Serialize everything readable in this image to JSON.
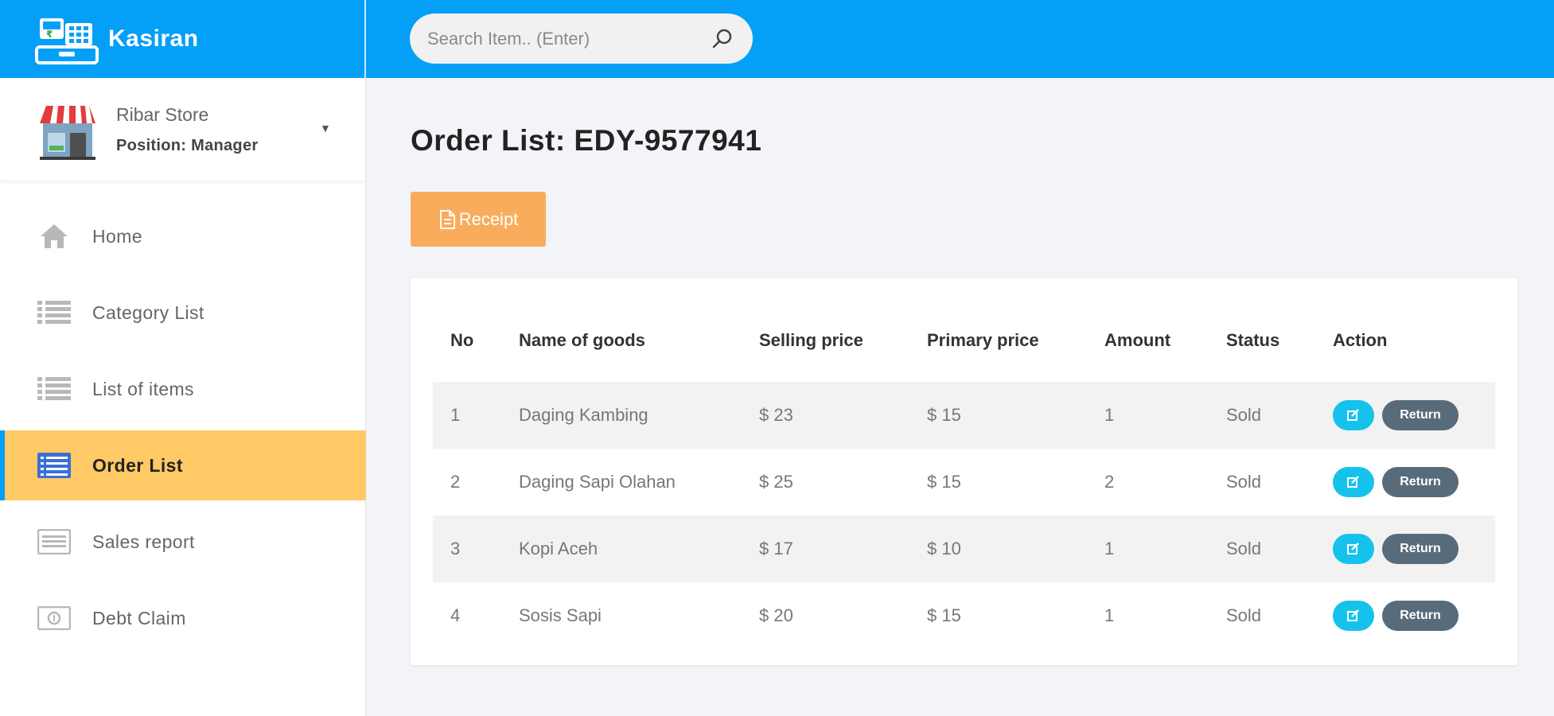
{
  "brand": {
    "name": "Kasiran"
  },
  "search": {
    "placeholder": "Search Item.. (Enter)"
  },
  "store": {
    "name": "Ribar Store",
    "position": "Position: Manager"
  },
  "nav": [
    {
      "label": "Home",
      "icon": "home-icon"
    },
    {
      "label": "Category List",
      "icon": "list-icon"
    },
    {
      "label": "List of items",
      "icon": "list-icon"
    },
    {
      "label": "Order List",
      "icon": "order-list-icon",
      "active": true
    },
    {
      "label": "Sales report",
      "icon": "report-icon"
    },
    {
      "label": "Debt Claim",
      "icon": "money-icon"
    }
  ],
  "page": {
    "title": "Order List: EDY-9577941",
    "receipt_label": "Receipt"
  },
  "table": {
    "headers": [
      "No",
      "Name of goods",
      "Selling price",
      "Primary price",
      "Amount",
      "Status",
      "Action"
    ],
    "rows": [
      {
        "no": "1",
        "name": "Daging Kambing",
        "selling": "$ 23",
        "primary": "$ 15",
        "amount": "1",
        "status": "Sold"
      },
      {
        "no": "2",
        "name": "Daging Sapi Olahan",
        "selling": "$ 25",
        "primary": "$ 15",
        "amount": "2",
        "status": "Sold"
      },
      {
        "no": "3",
        "name": "Kopi Aceh",
        "selling": "$ 17",
        "primary": "$ 10",
        "amount": "1",
        "status": "Sold"
      },
      {
        "no": "4",
        "name": "Sosis Sapi",
        "selling": "$ 20",
        "primary": "$ 15",
        "amount": "1",
        "status": "Sold"
      }
    ],
    "return_label": "Return"
  },
  "colors": {
    "primary": "#049ff7",
    "active_nav": "#ffc966",
    "receipt": "#f9ad5c",
    "edit": "#15c2ec",
    "return": "#586b7a"
  }
}
